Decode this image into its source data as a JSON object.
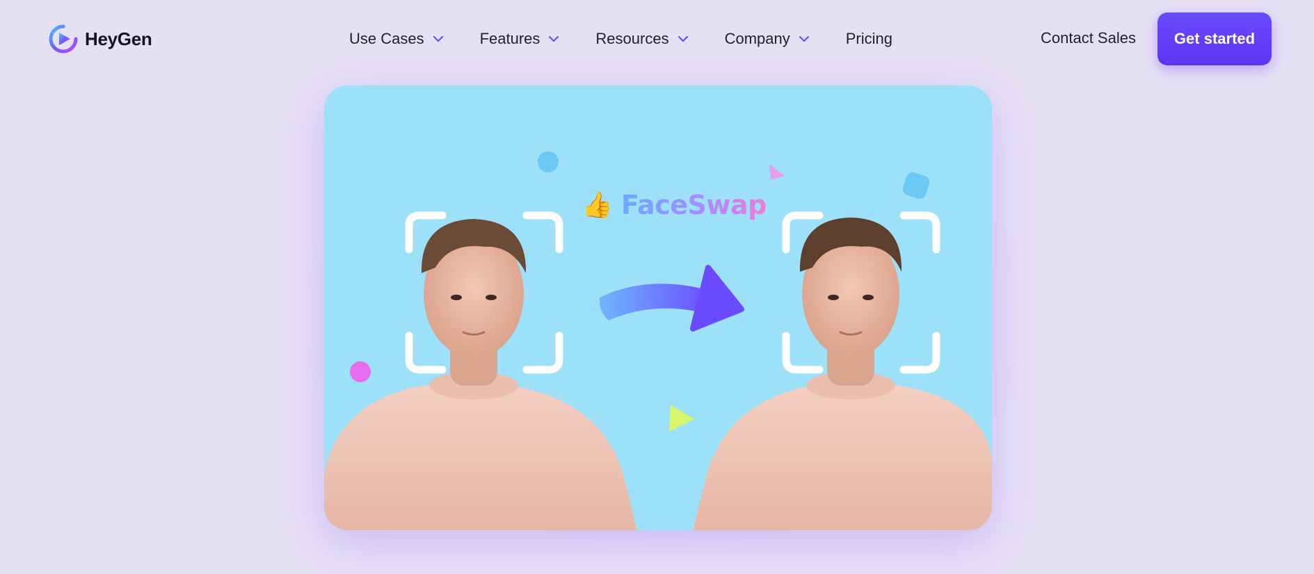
{
  "header": {
    "brand": "HeyGen",
    "nav": [
      {
        "label": "Use Cases",
        "has_dropdown": true
      },
      {
        "label": "Features",
        "has_dropdown": true
      },
      {
        "label": "Resources",
        "has_dropdown": true
      },
      {
        "label": "Company",
        "has_dropdown": true
      },
      {
        "label": "Pricing",
        "has_dropdown": false
      }
    ],
    "contact_label": "Contact Sales",
    "cta_label": "Get started"
  },
  "hero": {
    "emoji": "👍",
    "title": "FaceSwap"
  },
  "colors": {
    "page_bg": "#e6e0f4",
    "accent": "#5a35f0",
    "card_bg": "#9de1f9",
    "shirt": "#efc3b4"
  },
  "icons": [
    "heygen-logo-icon",
    "chevron-down-icon",
    "thumbs-up-icon",
    "arrow-right-icon"
  ]
}
